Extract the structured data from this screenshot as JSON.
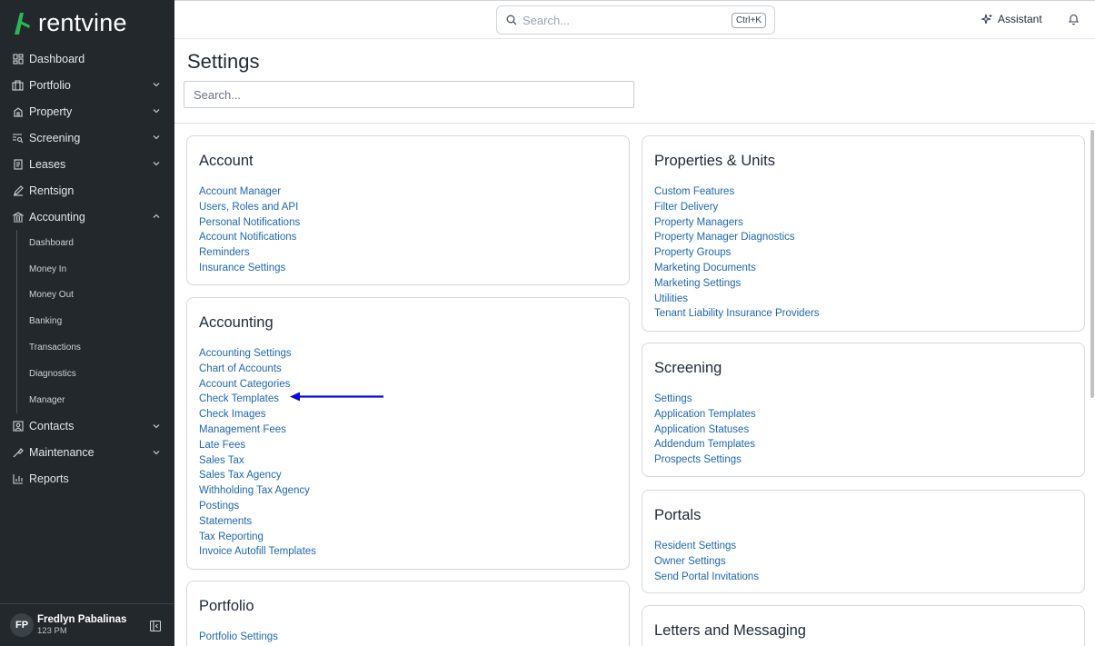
{
  "app": {
    "brand": "rentvine"
  },
  "sidebar": {
    "items": [
      {
        "label": "Dashboard",
        "icon": "dashboard-icon"
      },
      {
        "label": "Portfolio",
        "icon": "portfolio-icon"
      },
      {
        "label": "Property",
        "icon": "property-icon"
      },
      {
        "label": "Screening",
        "icon": "screening-icon"
      },
      {
        "label": "Leases",
        "icon": "leases-icon"
      },
      {
        "label": "Rentsign",
        "icon": "rentsign-icon"
      },
      {
        "label": "Accounting",
        "icon": "accounting-icon"
      }
    ],
    "accounting_sub": [
      "Dashboard",
      "Money In",
      "Money Out",
      "Banking",
      "Transactions",
      "Diagnostics",
      "Manager"
    ],
    "items_after": [
      {
        "label": "Contacts",
        "icon": "contacts-icon"
      },
      {
        "label": "Maintenance",
        "icon": "maintenance-icon"
      },
      {
        "label": "Reports",
        "icon": "reports-icon"
      }
    ],
    "user": {
      "initials": "FP",
      "name": "Fredlyn Pabalinas",
      "time": "123 PM"
    }
  },
  "topbar": {
    "search_placeholder": "Search...",
    "shortcut": "Ctrl+K",
    "assistant_label": "Assistant"
  },
  "page": {
    "title": "Settings",
    "search_placeholder": "Search..."
  },
  "cards": {
    "account": {
      "title": "Account",
      "links": [
        "Account Manager",
        "Users, Roles and API",
        "Personal Notifications",
        "Account Notifications",
        "Reminders",
        "Insurance Settings"
      ]
    },
    "accounting": {
      "title": "Accounting",
      "links": [
        "Accounting Settings",
        "Chart of Accounts",
        "Account Categories",
        "Check Templates",
        "Check Images",
        "Management Fees",
        "Late Fees",
        "Sales Tax",
        "Sales Tax Agency",
        "Withholding Tax Agency",
        "Postings",
        "Statements",
        "Tax Reporting",
        "Invoice Autofill Templates"
      ]
    },
    "portfolio": {
      "title": "Portfolio",
      "links": [
        "Portfolio Settings"
      ]
    },
    "properties": {
      "title": "Properties & Units",
      "links": [
        "Custom Features",
        "Filter Delivery",
        "Property Managers",
        "Property Manager Diagnostics",
        "Property Groups",
        "Marketing Documents",
        "Marketing Settings",
        "Utilities",
        "Tenant Liability Insurance Providers"
      ]
    },
    "screening": {
      "title": "Screening",
      "links": [
        "Settings",
        "Application Templates",
        "Application Statuses",
        "Addendum Templates",
        "Prospects Settings"
      ]
    },
    "portals": {
      "title": "Portals",
      "links": [
        "Resident Settings",
        "Owner Settings",
        "Send Portal Invitations"
      ]
    },
    "letters": {
      "title": "Letters and Messaging",
      "links": []
    }
  },
  "colors": {
    "sidebar_bg": "#23282d",
    "link": "#1e67b0",
    "brand_green": "#2fb457",
    "arrow": "#0a0adc"
  }
}
